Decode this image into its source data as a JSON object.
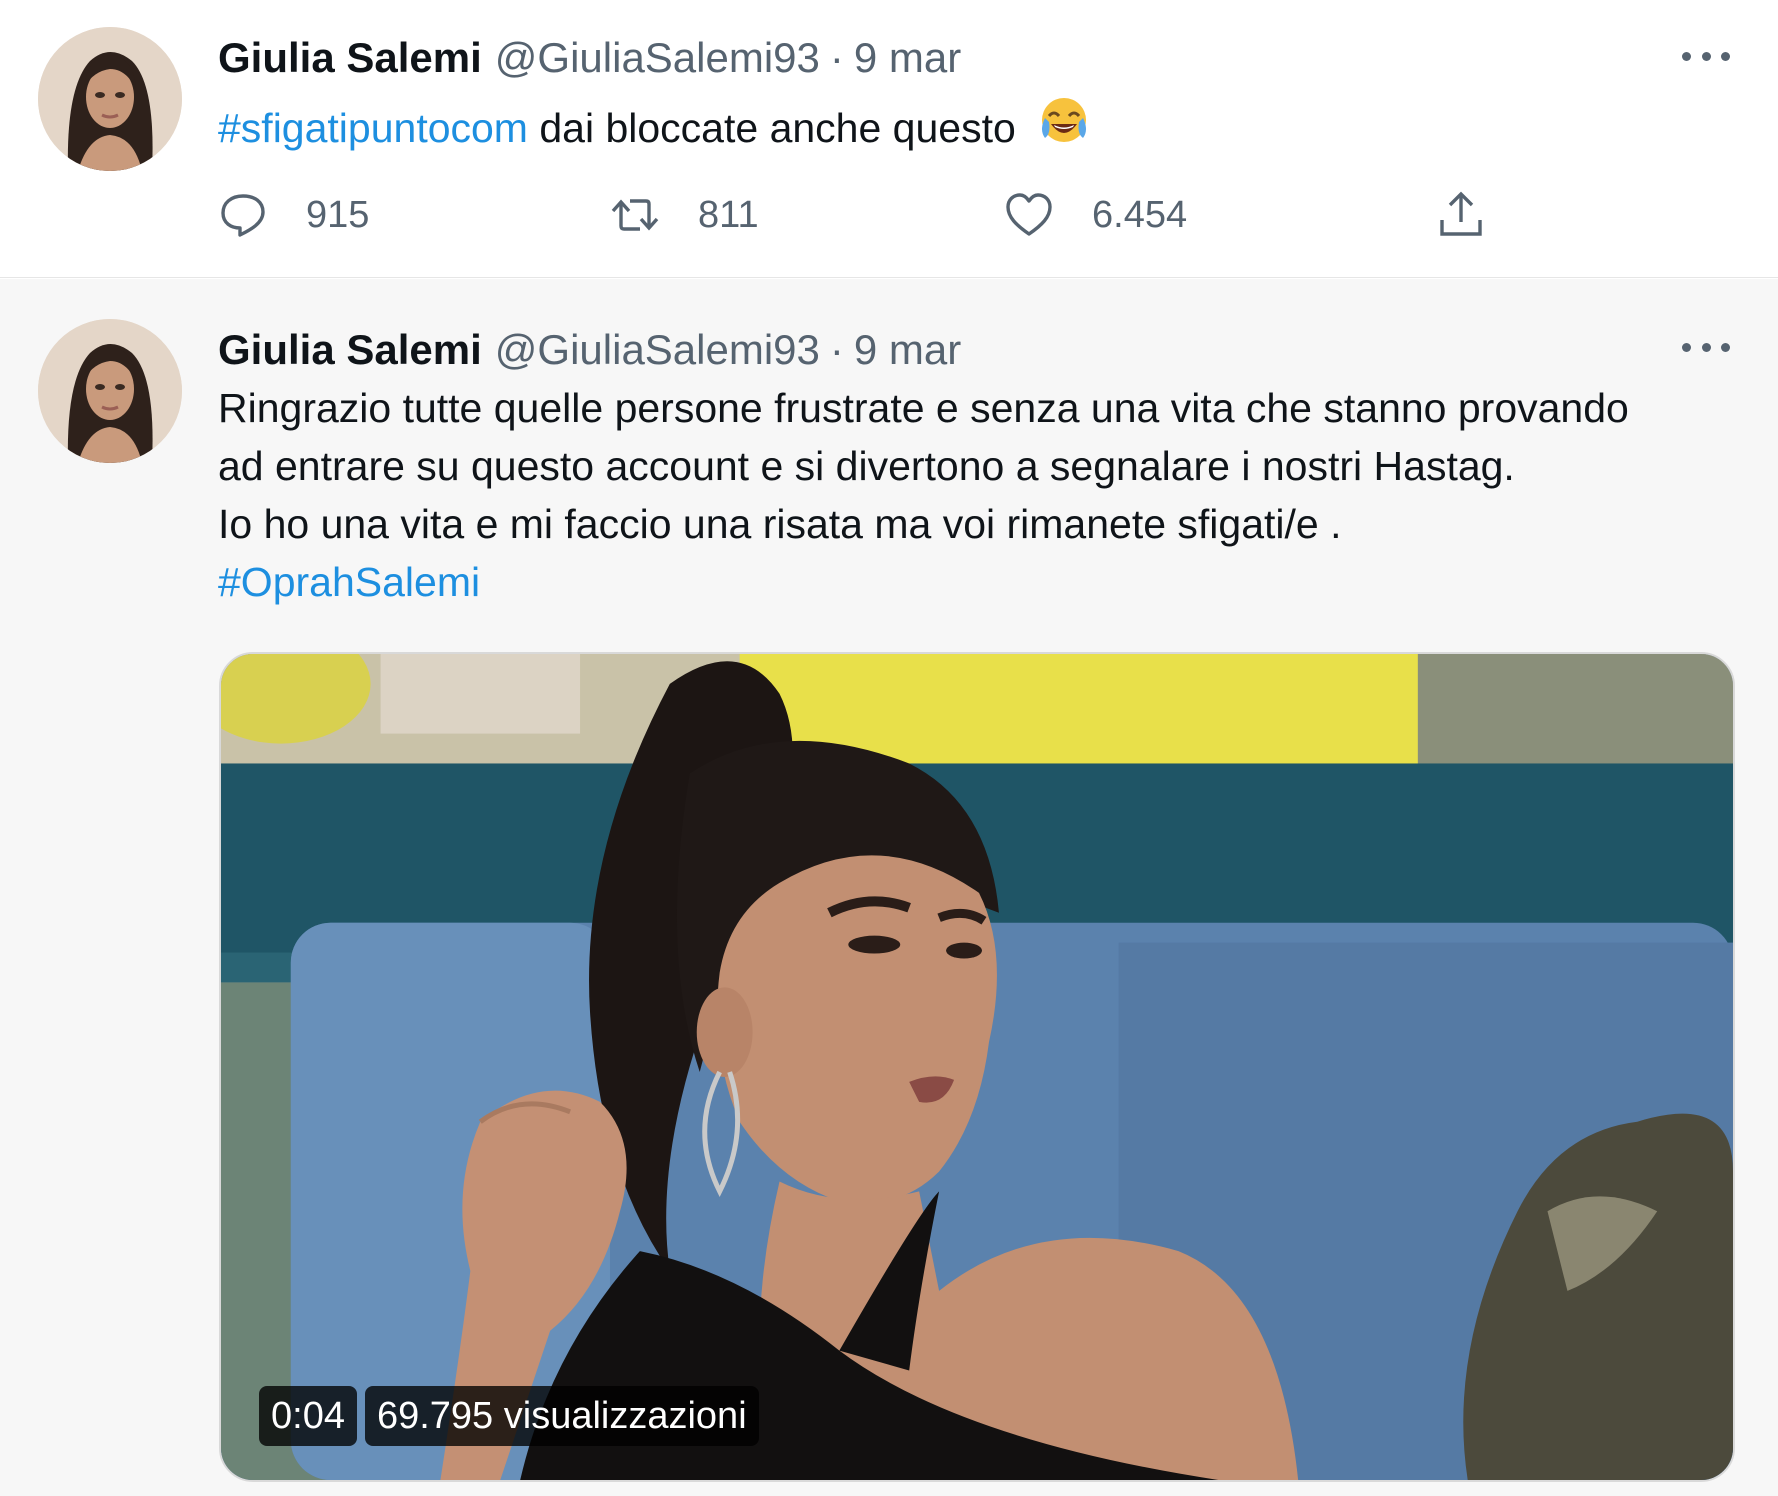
{
  "tweets": [
    {
      "author_name": "Giulia Salemi",
      "author_handle": "@GiuliaSalemi93",
      "separator": "·",
      "date": "9 mar",
      "hashtag": "#sfigatipuntocom",
      "text": " dai bloccate anche questo",
      "emoji": "face-with-tears-of-joy",
      "stats": {
        "replies": "915",
        "retweets": "811",
        "likes": "6.454"
      }
    },
    {
      "author_name": "Giulia Salemi",
      "author_handle": "@GiuliaSalemi93",
      "separator": "·",
      "date": "9 mar",
      "lines": [
        "Ringrazio tutte quelle persone frustrate e senza una vita che stanno provando",
        "ad entrare su questo account e si divertono a segnalare i nostri Hastag.",
        "Io ho una vita e mi faccio una risata ma voi rimanete sfigati/e ."
      ],
      "hashtag": "#OprahSalemi",
      "video": {
        "time": "0:04",
        "views": "69.795 visualizzazioni"
      }
    }
  ],
  "icons": {
    "reply": "comment-bubble-icon",
    "retweet": "retweet-arrows-icon",
    "like": "heart-icon",
    "share": "share-upload-icon",
    "more": "more-dots-icon"
  },
  "colors": {
    "hashtag": "#1d8fe0",
    "secondary_text": "#566370",
    "primary_text": "#0f1419"
  }
}
